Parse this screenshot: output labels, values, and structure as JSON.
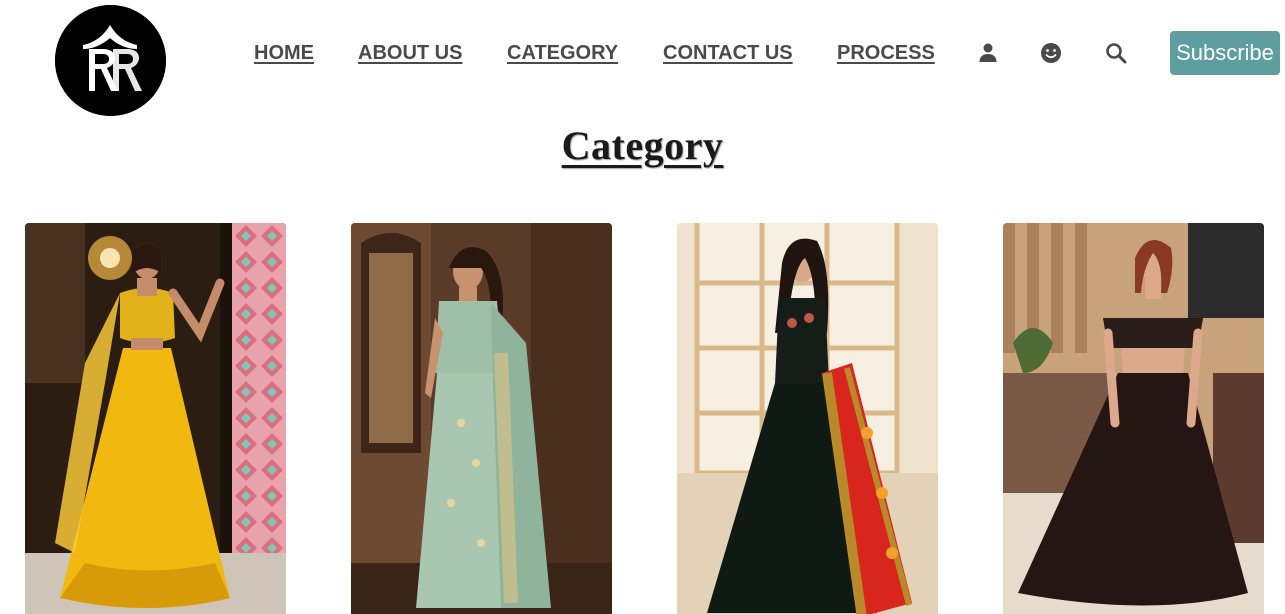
{
  "logo": {
    "icon": "rr-monogram-logo"
  },
  "nav": {
    "items": [
      {
        "label": "HOME"
      },
      {
        "label": "ABOUT US"
      },
      {
        "label": "CATEGORY"
      },
      {
        "label": "CONTACT US"
      },
      {
        "label": "PROCESS"
      }
    ],
    "icons": [
      "user-icon",
      "smile-icon",
      "search-icon"
    ],
    "subscribe_label": "Subscribe"
  },
  "main": {
    "title": "Category"
  },
  "categories": [
    {
      "image": "yellow-lehenga-photo"
    },
    {
      "image": "mint-green-saree-photo"
    },
    {
      "image": "black-gown-red-dupatta-photo"
    },
    {
      "image": "black-off-shoulder-gown-photo"
    }
  ],
  "colors": {
    "accent": "#5f9ea0",
    "nav_text": "#4a4a4a",
    "title_text": "#1a1a1a"
  }
}
